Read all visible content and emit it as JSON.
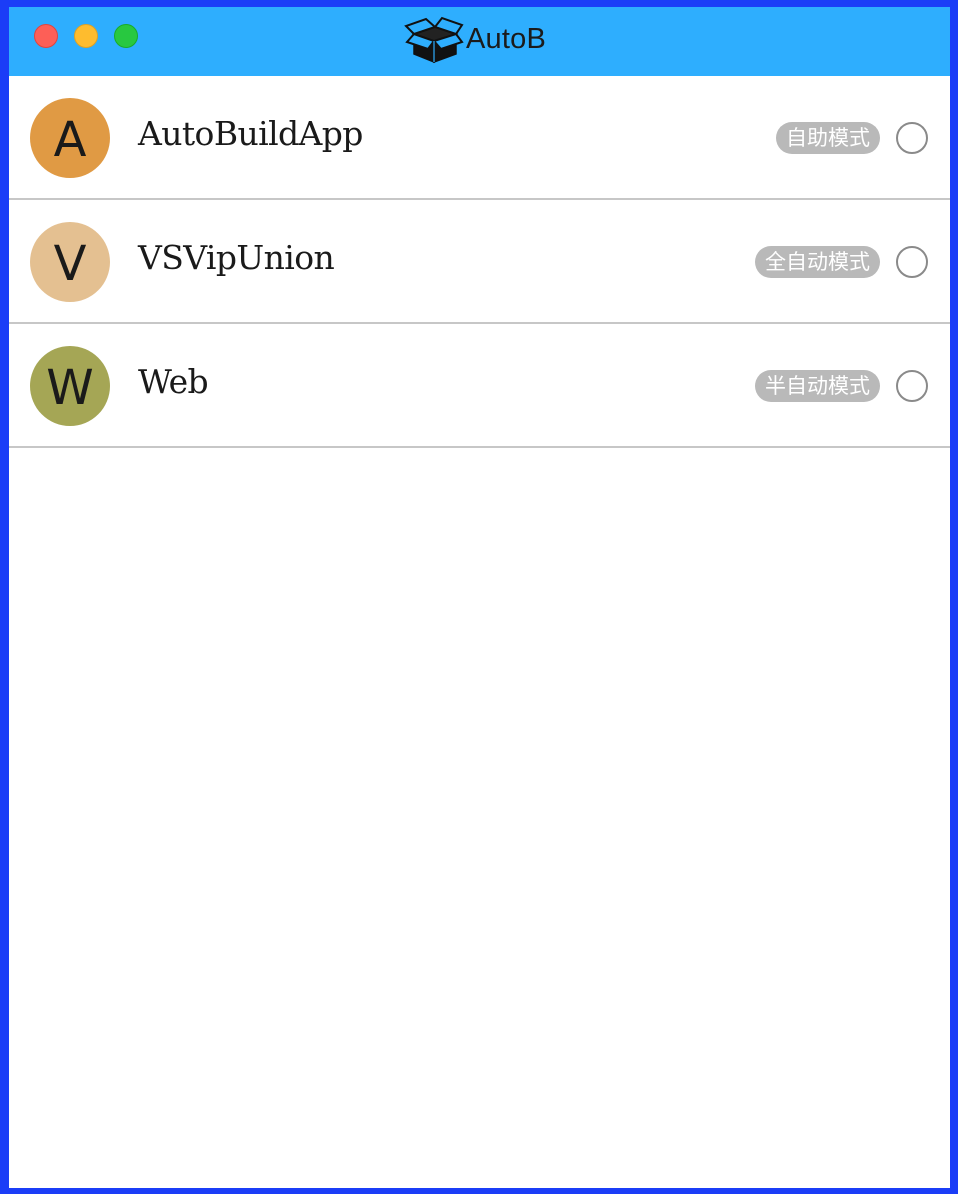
{
  "window": {
    "title": "AutoB",
    "title_icon": "open-box-icon",
    "titlebar_color": "#2eaefe",
    "frame_color": "#1b3df7"
  },
  "projects": [
    {
      "initial": "A",
      "name": "AutoBuildApp",
      "mode": "自助模式",
      "avatar_color": "#e09a44",
      "selected": false
    },
    {
      "initial": "V",
      "name": "VSVipUnion",
      "mode": "全自动模式",
      "avatar_color": "#e4c091",
      "selected": false
    },
    {
      "initial": "W",
      "name": "Web",
      "mode": "半自动模式",
      "avatar_color": "#a5a655",
      "selected": false
    }
  ]
}
